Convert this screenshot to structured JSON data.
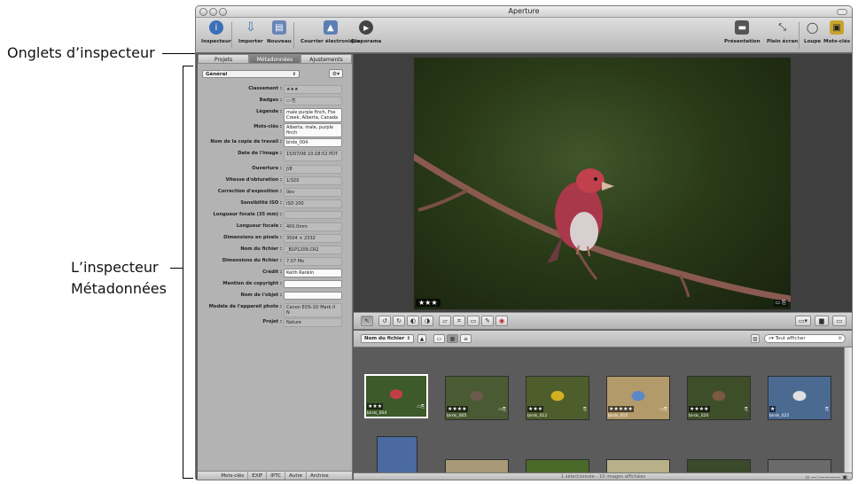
{
  "callouts": {
    "tabs": "Onglets d’inspecteur",
    "inspector_line1": "L’inspecteur",
    "inspector_line2": "Métadonnées"
  },
  "window": {
    "title": "Aperture"
  },
  "toolbar": {
    "inspector": "Inspecteur",
    "import": "Importer",
    "new": "Nouveau",
    "email": "Courrier électronique",
    "slideshow": "Diaporama",
    "presentation": "Présentation",
    "fullscreen": "Plein écran",
    "loupe": "Loupe",
    "keywords": "Mots-clés"
  },
  "inspector": {
    "tabs": [
      "Projets",
      "Métadonnées",
      "Ajustements"
    ],
    "view_select": "Général",
    "fields": [
      {
        "label": "Classement :",
        "value": "★★★"
      },
      {
        "label": "Badges :",
        "value": "▭ ⎘"
      },
      {
        "label": "Légende :",
        "value": "male purple finch, Fox Creek, Alberta, Canada"
      },
      {
        "label": "Mots-clés :",
        "value": "Alberta, male, purple finch"
      },
      {
        "label": "Nom de la copie de travail :",
        "value": "birds_004"
      },
      {
        "label": "Date de l'image :",
        "value": "15/07/06 10:18:52 PDT"
      },
      {
        "label": "Ouverture :",
        "value": "ƒ/8"
      },
      {
        "label": "Vitesse d'obturation :",
        "value": "1/320"
      },
      {
        "label": "Correction d'exposition :",
        "value": "0ev"
      },
      {
        "label": "Sensibilité ISO :",
        "value": "ISO 200"
      },
      {
        "label": "Longueur focale (35 mm) :",
        "value": ""
      },
      {
        "label": "Longueur focale :",
        "value": "400.0mm"
      },
      {
        "label": "Dimensions en pixels :",
        "value": "3504 × 2332"
      },
      {
        "label": "Nom du fichier :",
        "value": "_B1P1209.CR2"
      },
      {
        "label": "Dimensions du fichier :",
        "value": "7.07 Mo"
      },
      {
        "label": "Crédit :",
        "value": "Keith Rankin"
      },
      {
        "label": "Mention de copyright :",
        "value": ""
      },
      {
        "label": "Nom de l'objet :",
        "value": ""
      },
      {
        "label": "Modèle de l'appareil photo :",
        "value": "Canon EOS-1D Mark II N"
      },
      {
        "label": "Projet :",
        "value": "Nature"
      }
    ],
    "bottom_tabs": [
      "Mots-clés",
      "EXIF",
      "IPTC",
      "Autre",
      "Archive"
    ]
  },
  "viewer": {
    "rating": "★★★"
  },
  "browser": {
    "sort_label": "Nom du fichier",
    "search_placeholder": "Tout afficher",
    "thumbnails": [
      {
        "name": "birds_004",
        "stars": "★★★",
        "bg": "#3c5a2a",
        "accent": "#c0404a"
      },
      {
        "name": "birds_005",
        "stars": "★★★★",
        "bg": "#4a5a32",
        "accent": "#6a5a4a"
      },
      {
        "name": "birds_012",
        "stars": "★★★",
        "bg": "#4d5d2b",
        "accent": "#d2b020"
      },
      {
        "name": "birds_015",
        "stars": "★★★★★",
        "bg": "#b39a6a",
        "accent": "#5b87c8"
      },
      {
        "name": "birds_020",
        "stars": "★★★★",
        "bg": "#3e4e28",
        "accent": "#7a5a40"
      },
      {
        "name": "birds_025",
        "stars": "★",
        "bg": "#4a6a92",
        "accent": "#e0e0e0"
      }
    ],
    "status": "1 sélectionnée - 10 images affichées"
  }
}
